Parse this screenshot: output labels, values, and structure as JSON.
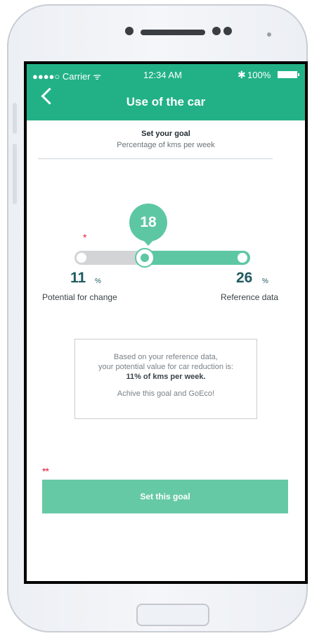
{
  "status_bar": {
    "carrier": "●●●●○ Carrier ᯤ",
    "time": "12:34 AM",
    "bluetooth": "✱",
    "battery": "100%"
  },
  "header": {
    "title": "Use of the car"
  },
  "goal": {
    "title": "Set your goal",
    "subtitle": "Percentage of kms per week"
  },
  "slider": {
    "current_value": "18",
    "min_value": "11",
    "min_unit": "%",
    "min_label": "Potential for change",
    "max_value": "26",
    "max_unit": "%",
    "max_label": "Reference data",
    "required_marker": "*"
  },
  "info": {
    "line1": "Based on your reference data,",
    "line2": "your potential value for car reduction is:",
    "line3": "11% of kms per week.",
    "line4": "Achive this goal and GoEco!"
  },
  "action": {
    "required_marker": "**",
    "button_label": "Set this goal"
  }
}
